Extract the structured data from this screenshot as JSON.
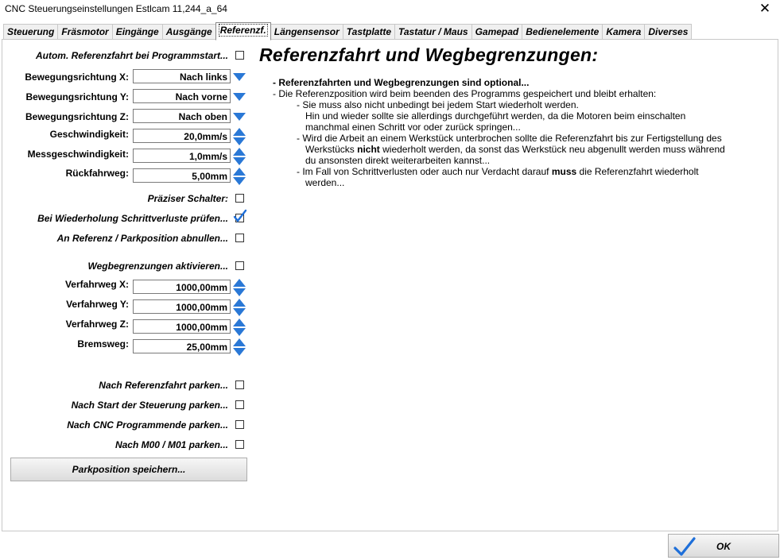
{
  "window": {
    "title": "CNC Steuerungseinstellungen Estlcam 11,244_a_64",
    "close_glyph": "✕"
  },
  "tabs": [
    "Steuerung",
    "Fräsmotor",
    "Eingänge",
    "Ausgänge",
    "Referenzf.",
    "Längensensor",
    "Tastplatte",
    "Tastatur / Maus",
    "Gamepad",
    "Bedienelemente",
    "Kamera",
    "Diverses"
  ],
  "active_tab": "Referenzf.",
  "left": {
    "autom_ref": "Autom. Referenzfahrt bei Programmstart...",
    "dir_x_label": "Bewegungsrichtung X:",
    "dir_x_value": "Nach links",
    "dir_y_label": "Bewegungsrichtung Y:",
    "dir_y_value": "Nach vorne",
    "dir_z_label": "Bewegungsrichtung Z:",
    "dir_z_value": "Nach oben",
    "speed_label": "Geschwindigkeit:",
    "speed_value": "20,0mm/s",
    "mspeed_label": "Messgeschwindigkeit:",
    "mspeed_value": "1,0mm/s",
    "back_label": "Rückfahrweg:",
    "back_value": "5,00mm",
    "precise": "Präziser Schalter:",
    "repeat_check": "Bei Wiederholung Schrittverluste prüfen...",
    "zero_at_ref": "An Referenz / Parkposition abnullen...",
    "limits": "Wegbegrenzungen aktivieren...",
    "travel_x_label": "Verfahrweg X:",
    "travel_x_value": "1000,00mm",
    "travel_y_label": "Verfahrweg Y:",
    "travel_y_value": "1000,00mm",
    "travel_z_label": "Verfahrweg Z:",
    "travel_z_value": "1000,00mm",
    "brake_label": "Bremsweg:",
    "brake_value": "25,00mm",
    "park_after_ref": "Nach Referenzfahrt parken...",
    "park_after_start": "Nach Start der Steuerung parken...",
    "park_after_prog": "Nach CNC Programmende parken...",
    "park_after_m00": "Nach M00 / M01 parken...",
    "save_park_button": "Parkposition speichern..."
  },
  "right": {
    "heading": "Referenzfahrt  und Wegbegrenzungen:",
    "line1": "- Referenzfahrten  und  Wegbegrenzungen  sind optional...",
    "line2": "- Die Referenzposition wird beim beenden des Programms gespeichert und bleibt erhalten:",
    "line3": "- Sie muss also nicht unbedingt bei jedem Start wiederholt werden.",
    "line4": "Hin und wieder sollte sie allerdings durchgeführt werden, da die Motoren  beim einschalten",
    "line5": "manchmal einen Schritt vor oder zurück springen...",
    "line6": "- Wird die Arbeit an einem Werkstück unterbrochen sollte die Referenzfahrt  bis zur Fertigstellung des",
    "line7a": "Werkstücks ",
    "line7b": "nicht",
    "line7c": "  wiederholt werden, da sonst das Werkstück neu abgenullt werden muss während",
    "line8": "du ansonsten direkt weiterarbeiten kannst...",
    "line9a": "- Im Fall von Schrittverlusten oder auch nur Verdacht darauf ",
    "line9b": "muss",
    "line9c": " die Referenzfahrt  wiederholt",
    "line10": "werden..."
  },
  "footer": {
    "ok_button": "OK"
  },
  "checkboxes": {
    "autom_ref": false,
    "precise": false,
    "repeat_check": true,
    "zero_at_ref": false,
    "limits": false,
    "park_after_ref": false,
    "park_after_start": false,
    "park_after_prog": false,
    "park_after_m00": false
  },
  "colors": {
    "accent": "#2a78d6",
    "check": "#1e6fd9"
  }
}
